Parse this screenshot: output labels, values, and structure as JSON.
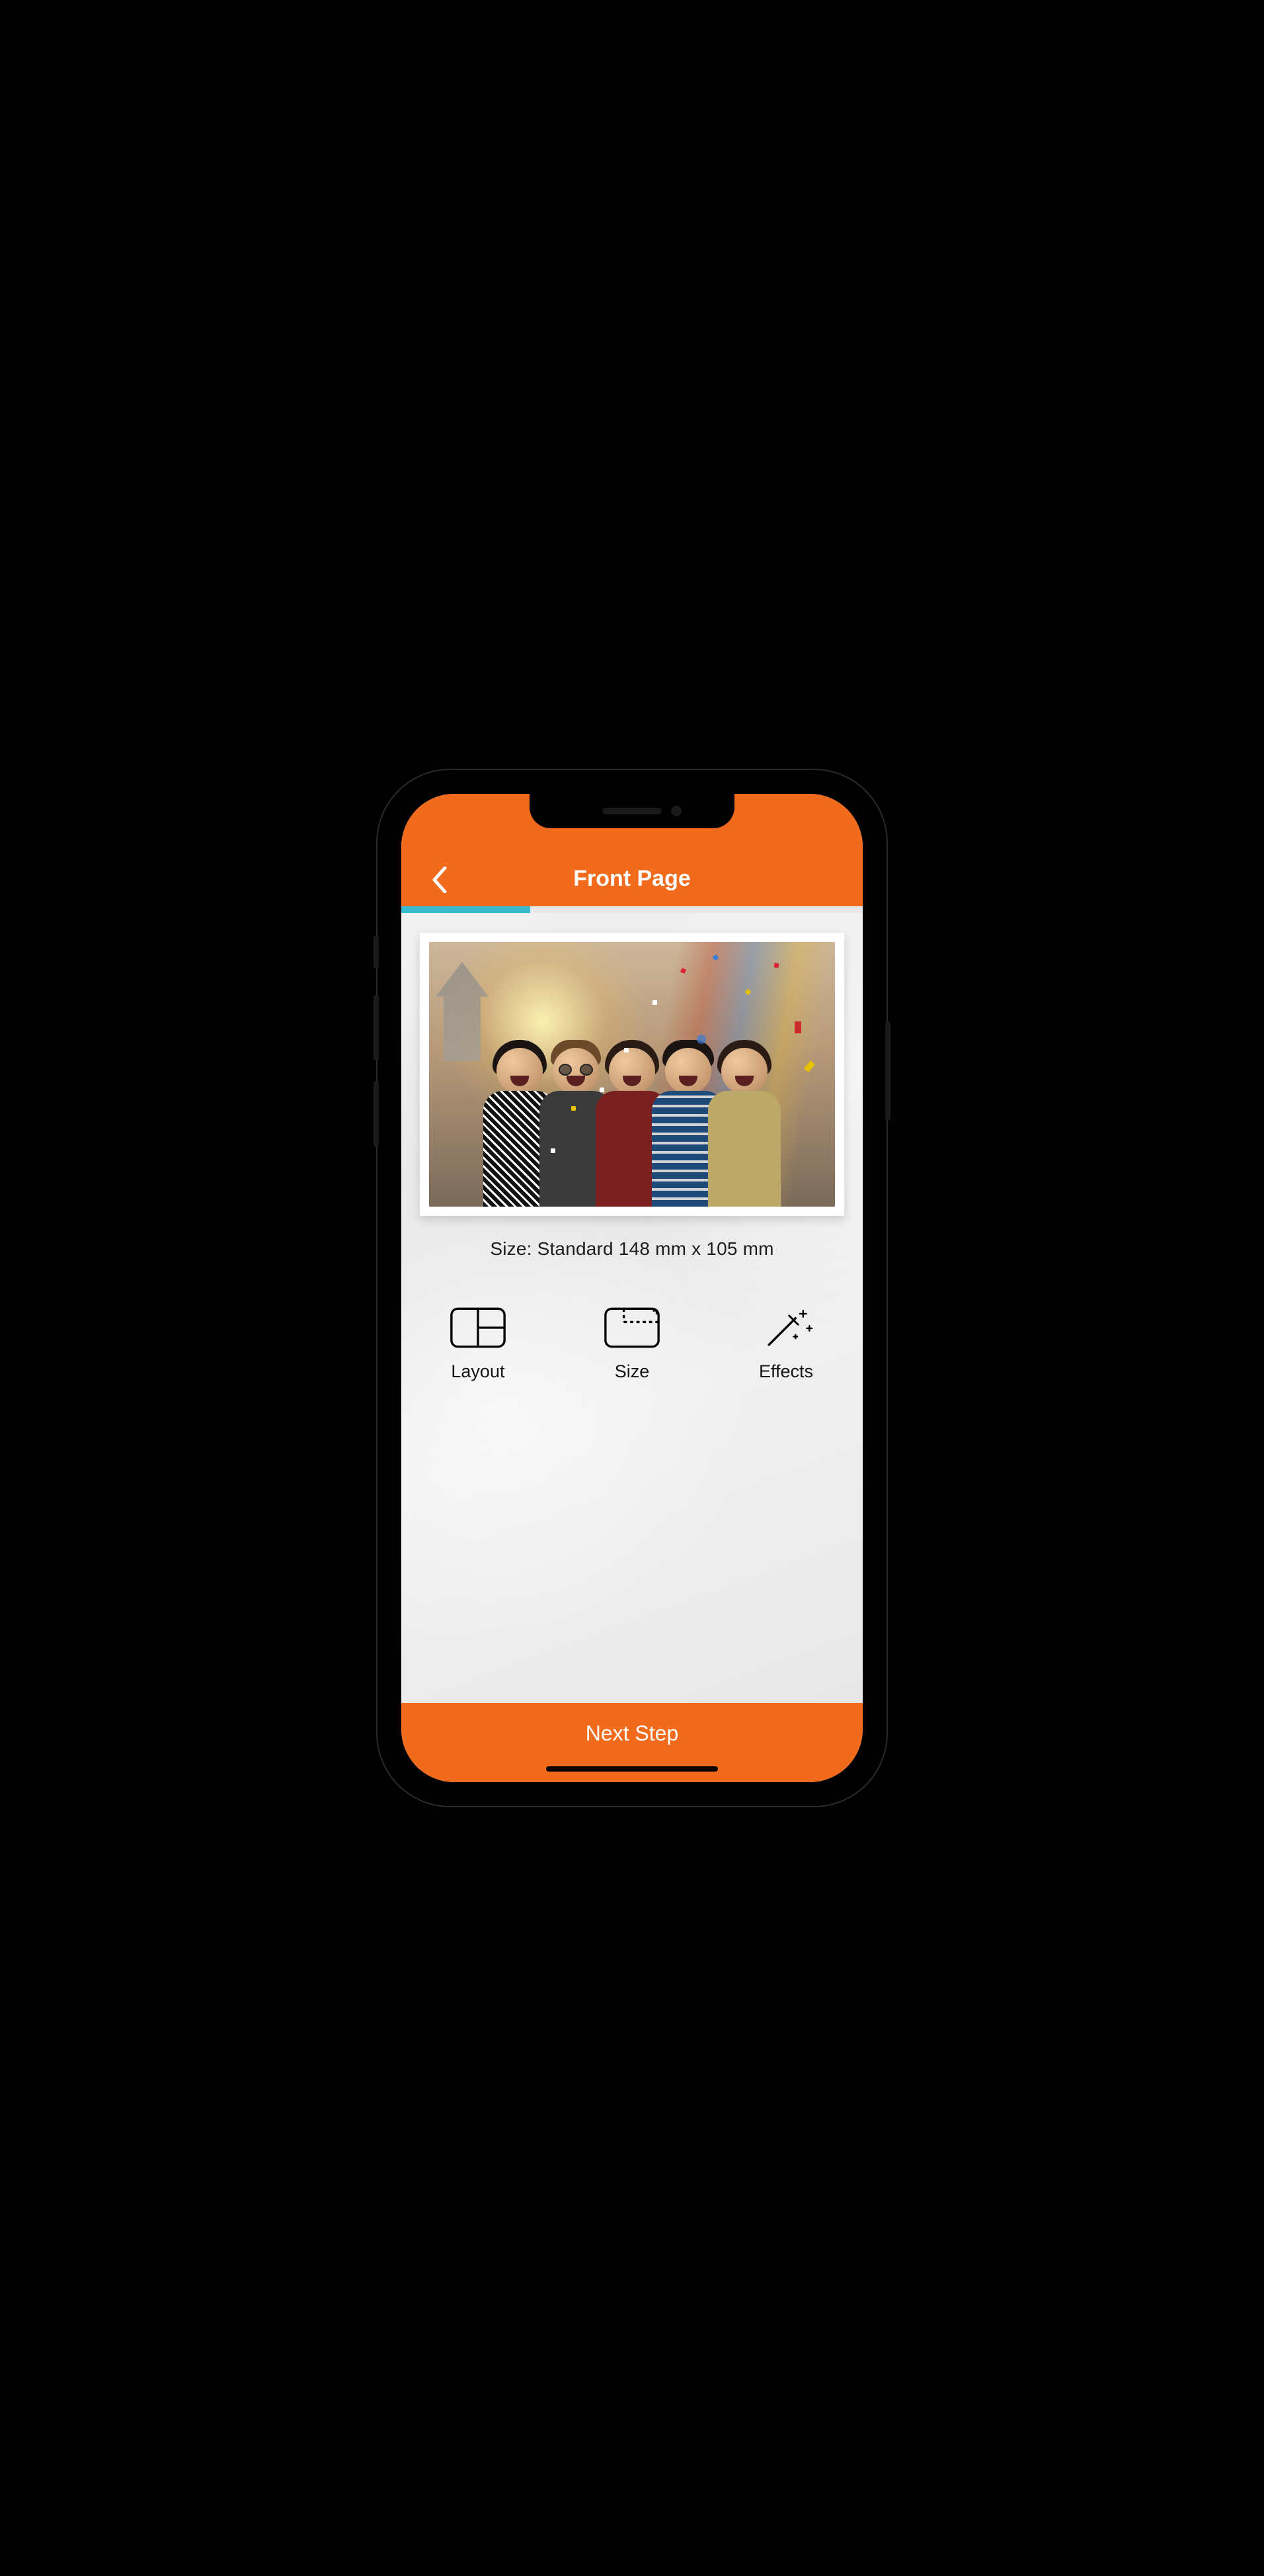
{
  "header": {
    "title": "Front Page"
  },
  "progress": {
    "percent": 28
  },
  "photo": {
    "alt": "Group of five friends laughing with confetti"
  },
  "size_label": "Size: Standard 148 mm x 105 mm",
  "tools": [
    {
      "id": "layout",
      "label": "Layout"
    },
    {
      "id": "size",
      "label": "Size"
    },
    {
      "id": "effects",
      "label": "Effects"
    }
  ],
  "footer": {
    "next_label": "Next Step"
  },
  "colors": {
    "accent": "#f26a1b",
    "progress": "#38b9cd"
  }
}
